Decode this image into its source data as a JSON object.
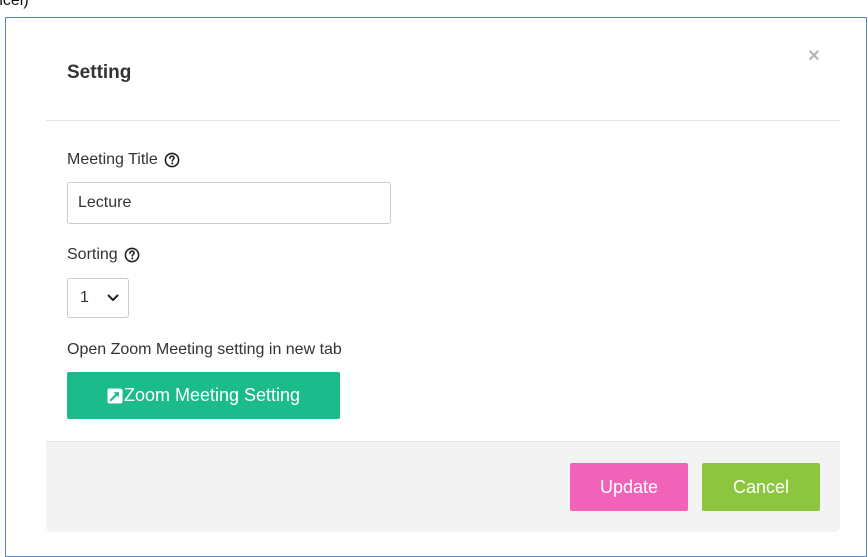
{
  "page_fragment_text": "ncel)",
  "modal": {
    "title": "Setting",
    "close_symbol": "×"
  },
  "meeting_title": {
    "label": "Meeting Title",
    "value": "Lecture",
    "help_icon": "question-circle-icon"
  },
  "sorting": {
    "label": "Sorting",
    "selected": "1",
    "help_icon": "question-circle-icon"
  },
  "zoom": {
    "label": "Open Zoom Meeting setting in new tab",
    "button_label": "Zoom Meeting Setting",
    "button_icon": "external-link-icon"
  },
  "footer": {
    "update_label": "Update",
    "cancel_label": "Cancel"
  },
  "colors": {
    "zoom_button": "#1cbb8c",
    "update_button": "#f063b8",
    "cancel_button": "#8cc63f",
    "frame_border": "#5b84c4"
  }
}
